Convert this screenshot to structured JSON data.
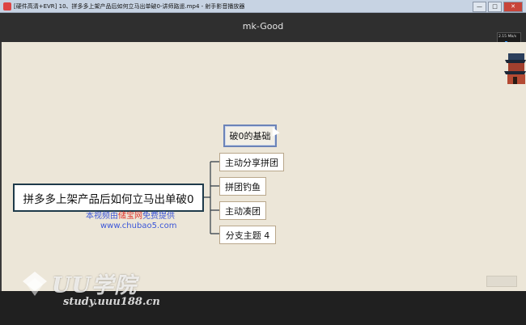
{
  "window": {
    "title": "[硬件高清+EVR] 10、拼多多上架产品后如何立马出单破0-讲师路遥.mp4 - 射手影音播放器",
    "minimize_glyph": "—",
    "maximize_glyph": "□",
    "close_glyph": "✕"
  },
  "video": {
    "header_title": "mk-Good",
    "stats_text": "2.15 Mb/s"
  },
  "mindmap": {
    "central_topic": "拼多多上架产品后如何立马出单破0",
    "root_node": "破0的基础",
    "branches": [
      "主动分享拼团",
      "拼团钓鱼",
      "主动凑团",
      "分支主题 4"
    ]
  },
  "promo": {
    "line1_prefix": "本视频由",
    "line1_brand": "储宝网",
    "line1_suffix": "免费提供",
    "line2": "www.chubao5.com"
  },
  "watermark": {
    "logo_text": "UU学院",
    "url": "study.uuu188.cn"
  },
  "colors": {
    "canvas_bg": "#ece6d8",
    "central_border": "#1e3a4a",
    "root_border": "#6b83b8",
    "branch_border": "#b9a78b",
    "connector": "#2e3b45",
    "promo_blue": "#3b56d8",
    "promo_red": "#e0362f"
  }
}
